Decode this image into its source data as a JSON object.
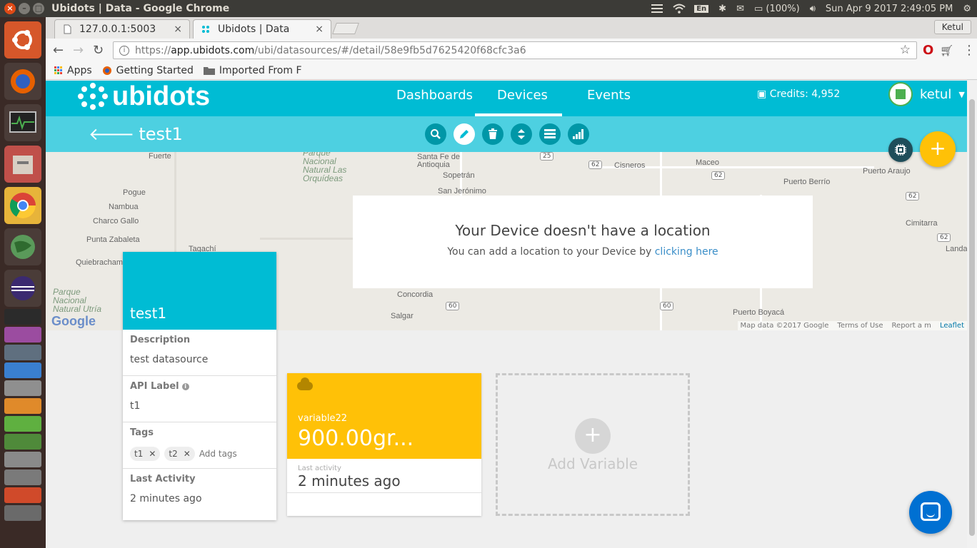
{
  "os": {
    "window_title": "Ubidots | Data - Google Chrome",
    "tray": {
      "keyboard": "En",
      "battery": "(100%)",
      "clock": "Sun Apr  9 2017  2:49:05 PM",
      "user": "Ketul"
    }
  },
  "browser": {
    "tabs": [
      {
        "label": "127.0.0.1:5003"
      },
      {
        "label": "Ubidots | Data"
      }
    ],
    "profile": "Ketul",
    "url_scheme": "https://",
    "url_host": "app.ubidots.com",
    "url_path": "/ubi/datasources/#/detail/58e9fb5d7625420f68cfc3a6",
    "bookmarks": [
      {
        "label": "Apps"
      },
      {
        "label": "Getting Started"
      },
      {
        "label": "Imported From F"
      }
    ]
  },
  "app": {
    "brand": "ubidots",
    "nav": [
      {
        "label": "Dashboards"
      },
      {
        "label": "Devices"
      },
      {
        "label": "Events"
      }
    ],
    "credits": "Credits: 4,952",
    "username": "ketul",
    "device_title": "test1",
    "fab": "+",
    "accent": "#00bcd4",
    "accent_light": "#4dd0e1",
    "amber": "#ffc107"
  },
  "map": {
    "labels": [
      "Fuerte",
      "Parque Nacional Natural Las Orquídeas",
      "Santa Fe de Antioquia",
      "Sopetrán",
      "San Jerónimo",
      "Cisneros",
      "Maceo",
      "Puerto Araujo",
      "Puerto Berrío",
      "Pogue",
      "Nambua",
      "Charco Gallo",
      "Punta Zabaleta",
      "Tagachí",
      "Quiebracham",
      "Parque Nacional Natural Utría",
      "Concordia",
      "Salgar",
      "Puerto Boyacá",
      "Cimitarra",
      "Landa"
    ],
    "shields": [
      "25",
      "62",
      "62",
      "62",
      "62",
      "60",
      "60"
    ],
    "attribution": [
      "Map data ©2017 Google",
      "Terms of Use",
      "Report a m"
    ],
    "leaflet": "Leaflet",
    "google": "Google"
  },
  "no_location": {
    "title": "Your Device doesn't have a location",
    "text": "You can add a location to your Device by ",
    "link": "clicking here"
  },
  "device_card": {
    "name": "test1",
    "description_label": "Description",
    "description": "test datasource",
    "api_label_label": "API Label",
    "api_label": "t1",
    "tags_label": "Tags",
    "tags": [
      "t1",
      "t2"
    ],
    "tags_placeholder": "Add tags",
    "last_activity_label": "Last Activity",
    "last_activity": "2 minutes ago"
  },
  "variable_card": {
    "name": "variable22",
    "value": "900.00gr...",
    "last_activity_label": "Last activity",
    "last_activity": "2 minutes ago"
  },
  "add_variable": {
    "label": "Add Variable",
    "plus": "+"
  }
}
